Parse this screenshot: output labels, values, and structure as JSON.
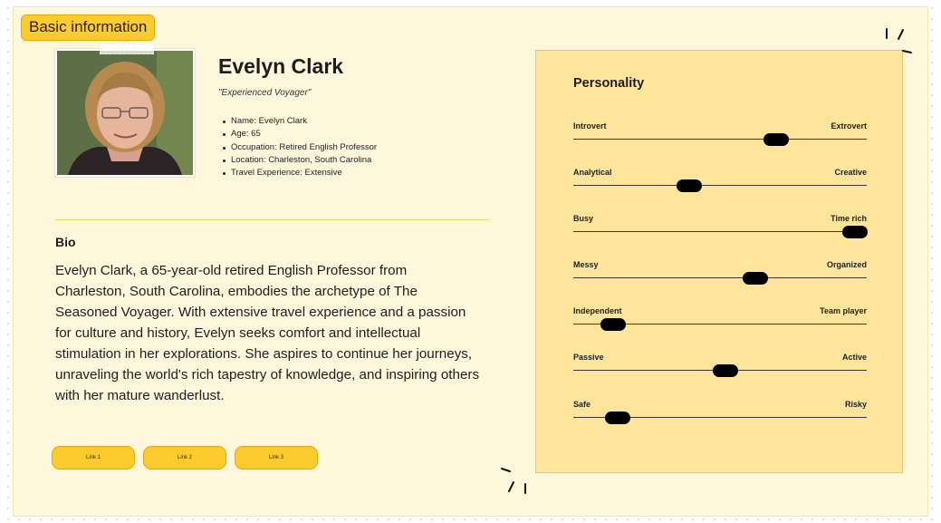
{
  "section_tag": "Basic information",
  "persona": {
    "name": "Evelyn Clark",
    "tagline": "\"Experienced Voyager\"",
    "facts": [
      "Name: Evelyn Clark",
      "Age: 65",
      "Occupation: Retired English Professor",
      "Location: Charleston, South Carolina",
      "Travel Experience: Extensive"
    ]
  },
  "bio": {
    "title": "Bio",
    "text": "Evelyn Clark, a 65-year-old retired English Professor from Charleston, South Carolina, embodies the archetype of The Seasoned Voyager. With extensive travel experience and a passion for culture and history, Evelyn seeks comfort and intellectual stimulation in her explorations. She aspires to continue her journeys, unraveling the world's rich tapestry of knowledge, and inspiring others with her mature wanderlust."
  },
  "links": [
    "Link 1",
    "Link 2",
    "Link 3"
  ],
  "personality": {
    "title": "Personality",
    "traits": [
      {
        "left": "Introvert",
        "right": "Extrovert",
        "value": 0.69
      },
      {
        "left": "Analytical",
        "right": "Creative",
        "value": 0.395
      },
      {
        "left": "Busy",
        "right": "Time rich",
        "value": 0.96
      },
      {
        "left": "Messy",
        "right": "Organized",
        "value": 0.62
      },
      {
        "left": "Independent",
        "right": "Team player",
        "value": 0.135
      },
      {
        "left": "Passive",
        "right": "Active",
        "value": 0.52
      },
      {
        "left": "Safe",
        "right": "Risky",
        "value": 0.15
      }
    ]
  },
  "colors": {
    "accent": "#fccb2d",
    "panel": "#ffe59c",
    "board": "#fff7dc",
    "knob": "#000000"
  },
  "icons": {
    "photo": "portrait-photo"
  }
}
